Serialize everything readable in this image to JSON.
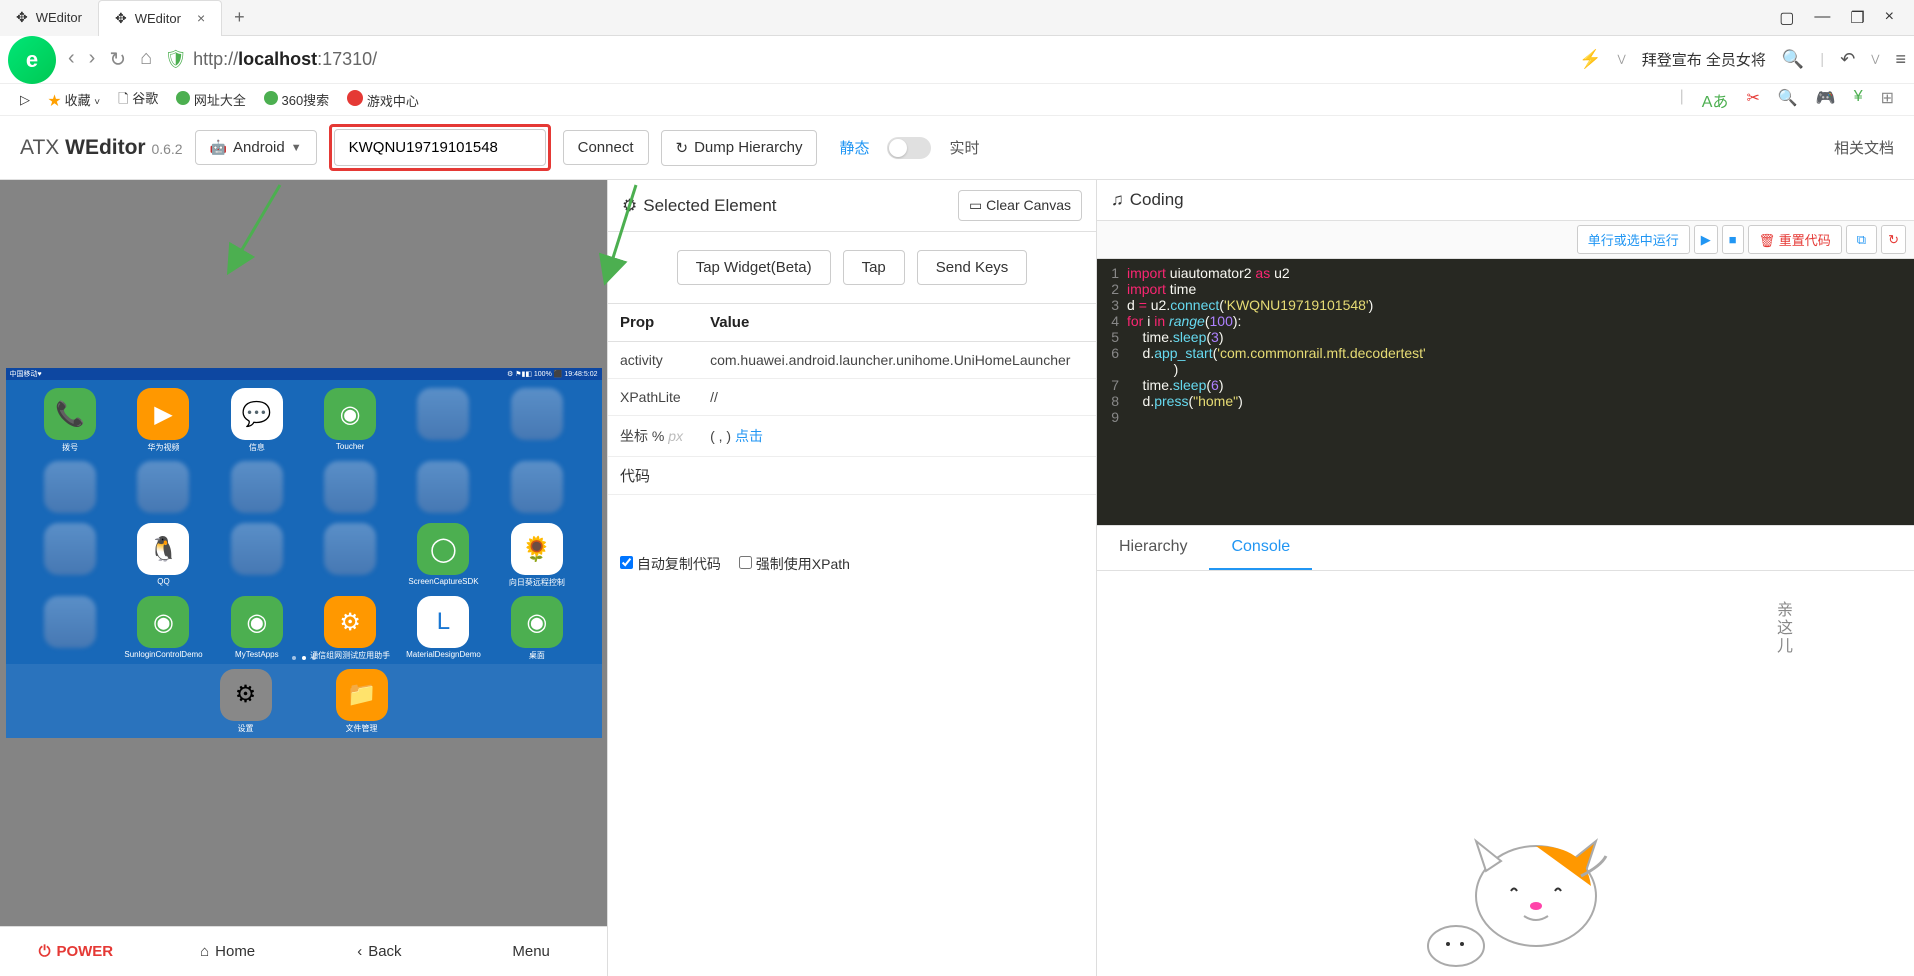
{
  "browser": {
    "tabs": [
      {
        "title": "WEditor"
      },
      {
        "title": "WEditor"
      }
    ],
    "url_proto": "http://",
    "url_host": "localhost",
    "url_port": ":17310/",
    "news": "拜登宣布 全员女将"
  },
  "bookmarks": {
    "fav": "收藏",
    "google": "谷歌",
    "wz": "网址大全",
    "search360": "360搜索",
    "game": "游戏中心"
  },
  "app": {
    "prefix": "ATX ",
    "name": "WEditor",
    "version": "0.6.2",
    "platform": "Android",
    "serial": "KWQNU19719101548",
    "connect": "Connect",
    "dump": "Dump Hierarchy",
    "static": "静态",
    "live": "实时",
    "docs": "相关文档"
  },
  "phone": {
    "status_left": "中国移动♥",
    "status_right": "⚙ ⚑▮◧ 100% ⬛ 19:48:5:02",
    "apps": [
      {
        "label": "拨号",
        "cls": "green",
        "glyph": "📞"
      },
      {
        "label": "华为视频",
        "cls": "orange",
        "glyph": "▶"
      },
      {
        "label": "信息",
        "cls": "white",
        "glyph": "💬"
      },
      {
        "label": "Toucher",
        "cls": "green",
        "glyph": "◉"
      },
      {
        "label": "",
        "cls": "blur",
        "glyph": ""
      },
      {
        "label": "",
        "cls": "blur",
        "glyph": ""
      },
      {
        "label": "",
        "cls": "blur",
        "glyph": ""
      },
      {
        "label": "",
        "cls": "blur",
        "glyph": ""
      },
      {
        "label": "",
        "cls": "blur",
        "glyph": ""
      },
      {
        "label": "",
        "cls": "blur",
        "glyph": ""
      },
      {
        "label": "",
        "cls": "blur",
        "glyph": ""
      },
      {
        "label": "",
        "cls": "blur",
        "glyph": ""
      },
      {
        "label": "",
        "cls": "blur",
        "glyph": ""
      },
      {
        "label": "QQ",
        "cls": "white",
        "glyph": "🐧"
      },
      {
        "label": "",
        "cls": "blur",
        "glyph": ""
      },
      {
        "label": "",
        "cls": "blur",
        "glyph": ""
      },
      {
        "label": "ScreenCaptureSDK",
        "cls": "green",
        "glyph": "◯"
      },
      {
        "label": "向日葵远程控制",
        "cls": "sun",
        "glyph": "🌻"
      },
      {
        "label": "",
        "cls": "blur",
        "glyph": ""
      },
      {
        "label": "SunloginControlDemo",
        "cls": "green",
        "glyph": "◉"
      },
      {
        "label": "MyTestApps",
        "cls": "green",
        "glyph": "◉"
      },
      {
        "label": "通信组网测试应用助手",
        "cls": "orange",
        "glyph": "⚙"
      },
      {
        "label": "MaterialDesignDemo",
        "cls": "white",
        "glyph": "L"
      },
      {
        "label": "桌面",
        "cls": "green",
        "glyph": "◉"
      }
    ],
    "dock": [
      {
        "label": "设置",
        "cls": "gray",
        "glyph": "⚙"
      },
      {
        "label": "文件管理",
        "cls": "orange",
        "glyph": "📁"
      }
    ],
    "buttons": {
      "power": "POWER",
      "home": "Home",
      "back": "Back",
      "menu": "Menu"
    }
  },
  "mid": {
    "header": "Selected Element",
    "clear": "Clear Canvas",
    "tapWidget": "Tap Widget(Beta)",
    "tap": "Tap",
    "sendKeys": "Send Keys",
    "th_prop": "Prop",
    "th_value": "Value",
    "rows": [
      {
        "k": "activity",
        "v": "com.huawei.android.launcher.unihome.UniHomeLauncher"
      },
      {
        "k": "XPathLite",
        "v": "//"
      }
    ],
    "coord_label": "坐标 %",
    "px": "px",
    "coord_val": "( , ) ",
    "click": "点击",
    "code_label": "代码",
    "auto_copy": "自动复制代码",
    "force_xpath": "强制使用XPath"
  },
  "right": {
    "header": "Coding",
    "run": "单行或选中运行",
    "reset": "重置代码",
    "tabs": {
      "hierarchy": "Hierarchy",
      "console": "Console"
    },
    "cat": "亲这儿"
  },
  "code_lines": [
    {
      "n": 1,
      "html": "<span class='kw'>import</span> uiautomator2 <span class='kw'>as</span> u2"
    },
    {
      "n": 2,
      "html": "<span class='kw'>import</span> time"
    },
    {
      "n": 3,
      "html": "d <span class='op'>=</span> u2.<span class='fn'>connect</span>(<span class='str'>'KWQNU19719101548'</span>)"
    },
    {
      "n": 4,
      "html": "<span class='kw'>for</span> i <span class='kw'>in</span> <span class='builtin'>range</span>(<span class='num'>100</span>):"
    },
    {
      "n": 5,
      "html": "    time.<span class='fn'>sleep</span>(<span class='num'>3</span>)"
    },
    {
      "n": 6,
      "html": "    d.<span class='fn'>app_start</span>(<span class='str'>'com.commonrail.mft.decodertest'</span><br>            )"
    },
    {
      "n": 7,
      "html": "    time.<span class='fn'>sleep</span>(<span class='num'>6</span>)"
    },
    {
      "n": 8,
      "html": "    d.<span class='fn'>press</span>(<span class='str'>\"home\"</span>)"
    },
    {
      "n": 9,
      "html": ""
    }
  ]
}
